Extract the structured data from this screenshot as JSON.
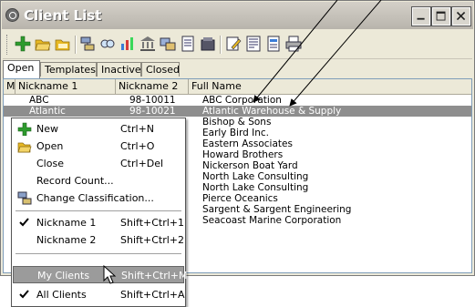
{
  "window": {
    "title": "Client List",
    "controls": [
      "minimize",
      "maximize",
      "close"
    ]
  },
  "toolbar": {
    "icons": [
      "new-icon",
      "open-icon",
      "open-folder-icon",
      "classification-icon",
      "find-icon",
      "chart-icon",
      "bank-icon",
      "transfer-icon",
      "report-icon",
      "database-icon",
      "edit-icon",
      "properties-icon",
      "note-icon",
      "print-icon"
    ]
  },
  "tabs": [
    "Open",
    "Templates",
    "Inactive",
    "Closed"
  ],
  "table": {
    "headers": [
      "M",
      "Nickname 1",
      "Nickname 2",
      "Full Name"
    ],
    "rows": [
      {
        "nick1": "ABC",
        "nick2": "98-10011",
        "full": "ABC Corporation"
      },
      {
        "nick1": "Atlantic",
        "nick2": "98-10021",
        "full": "Atlantic Warehouse & Supply"
      },
      {
        "nick1": "",
        "nick2": "",
        "full": "Bishop & Sons"
      },
      {
        "nick1": "",
        "nick2": "",
        "full": "Early Bird Inc."
      },
      {
        "nick1": "",
        "nick2": "",
        "full": "Eastern Associates"
      },
      {
        "nick1": "",
        "nick2": "",
        "full": "Howard Brothers"
      },
      {
        "nick1": "",
        "nick2": "",
        "full": "Nickerson Boat Yard"
      },
      {
        "nick1": "",
        "nick2": "",
        "full": "North Lake Consulting"
      },
      {
        "nick1": "",
        "nick2": "",
        "full": "North Lake Consulting"
      },
      {
        "nick1": "",
        "nick2": "",
        "full": "Pierce Oceanics"
      },
      {
        "nick1": "",
        "nick2": "",
        "full": "Sargent & Sargent Engineering"
      },
      {
        "nick1": "",
        "nick2": "",
        "full": "Seacoast Marine Corporation"
      }
    ],
    "selected_row": 1
  },
  "context_menu": {
    "items": [
      {
        "label": "New",
        "shortcut": "Ctrl+N",
        "icon": "new-icon"
      },
      {
        "label": "Open",
        "shortcut": "Ctrl+O",
        "icon": "open-icon"
      },
      {
        "label": "Close",
        "shortcut": "Ctrl+Del",
        "icon": ""
      },
      {
        "label": "Record Count...",
        "shortcut": "",
        "icon": ""
      },
      {
        "label": "Change Classification...",
        "shortcut": "",
        "icon": "classification-icon"
      },
      {
        "label": "Nickname 1",
        "shortcut": "Shift+Ctrl+1",
        "icon": "check-icon"
      },
      {
        "label": "Nickname 2",
        "shortcut": "Shift+Ctrl+2",
        "icon": ""
      },
      {
        "label": "My Clients",
        "shortcut": "Shift+Ctrl+M",
        "icon": ""
      },
      {
        "label": "All Clients",
        "shortcut": "Shift+Ctrl+A",
        "icon": "check-icon"
      }
    ],
    "highlighted": "My Clients"
  },
  "colors": {
    "selection": "#8e8e8e",
    "window_bg": "#ece9d8",
    "new_icon_green": "#2e9b2e",
    "folder_yellow": "#e8b923"
  }
}
